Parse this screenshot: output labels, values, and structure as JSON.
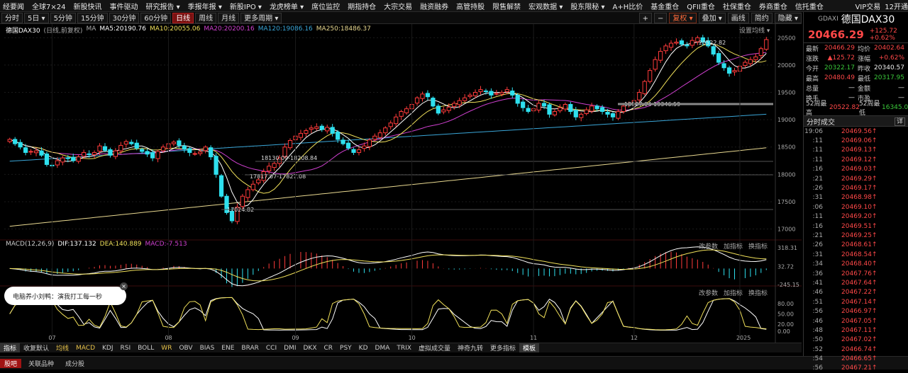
{
  "topnav": {
    "items": [
      "经要闻",
      "全球7×24",
      "新股快讯",
      "事件驱动",
      "研究报告 ▾",
      "季报年报 ▾",
      "新股IPO ▾",
      "龙虎榜单 ▾",
      "席位监控",
      "期指持仓",
      "大宗交易",
      "融资融券",
      "高管持股",
      "限售解禁",
      "宏观数据 ▾",
      "股东限秘 ▾",
      "A+H比价",
      "基金重仓",
      "QFII重仓",
      "社保重仓",
      "券商重仓",
      "信托重仓"
    ],
    "right": [
      "VIP交易",
      "12开通"
    ]
  },
  "toolbar": {
    "periods": [
      "分时",
      "5日 ▾",
      "5分钟",
      "15分钟",
      "30分钟",
      "60分钟",
      "日线",
      "周线",
      "月线",
      "更多周期 ▾"
    ],
    "active": "日线",
    "right": [
      "+",
      "−",
      "复权 ▾",
      "叠加 ▾",
      "画线",
      "简约",
      "隐藏 ▾"
    ]
  },
  "legend": {
    "name": "德国DAX30",
    "mode": "(日线,前复权)",
    "ma": "MA",
    "ma5": "MA5:20190.76",
    "ma10": "MA10:20055.06",
    "ma20": "MA20:20200.16",
    "ma120": "MA120:19086.16",
    "ma250": "MA250:18486.37",
    "settings": "设置均线 ▾",
    "colors": {
      "ma5": "#ffffff",
      "ma10": "#f0e05a",
      "ma20": "#d040d0",
      "ma120": "#3aa6d8",
      "ma250": "#e8d890"
    }
  },
  "macd": {
    "label": "MACD(12,26,9)",
    "dif": "DIF:137.132",
    "dea": "DEA:140.889",
    "macd": "MACD:-7.513",
    "links": [
      "改参数",
      "加指标",
      "换指标"
    ]
  },
  "sub": {
    "links": [
      "改参数",
      "加指标",
      "换指标"
    ]
  },
  "popup": {
    "text": "电脑养小刘鸭：演我打工每一秒",
    "close": "×"
  },
  "indicators": {
    "items": [
      "指标",
      "收复默认",
      "均线",
      "MACD",
      "KDJ",
      "RSI",
      "BOLL",
      "WR",
      "OBV",
      "BIAS",
      "ENE",
      "BRAR",
      "CCI",
      "DMI",
      "DKX",
      "CR",
      "PSY",
      "KD",
      "DMA",
      "TRIX",
      "虚拟成交量",
      "神奇九转",
      "更多指标",
      "模板"
    ],
    "selected": [
      "均线",
      "MACD",
      "WR"
    ]
  },
  "bottom": {
    "tabs": [
      "股吧",
      "关联品种",
      "成分股"
    ],
    "active": "股吧"
  },
  "side": {
    "code": "GDAXI",
    "name": "德国DAX30",
    "price": "20466.29",
    "change": "+125.72",
    "change_pct": "+0.62%",
    "rows": [
      {
        "l1": "最新",
        "v1": "20466.29",
        "c1": "red",
        "l2": "均价",
        "v2": "20402.64",
        "c2": "red"
      },
      {
        "l1": "涨跌",
        "v1": "▲125.72",
        "c1": "red",
        "l2": "涨幅",
        "v2": "+0.62%",
        "c2": "red"
      },
      {
        "l1": "今开",
        "v1": "20322.17",
        "c1": "green",
        "l2": "昨收",
        "v2": "20340.57",
        "c2": "white"
      },
      {
        "l1": "最高",
        "v1": "20480.49",
        "c1": "red",
        "l2": "最低",
        "v2": "20317.95",
        "c2": "green"
      },
      {
        "l1": "总量",
        "v1": "—",
        "c1": "white",
        "l2": "金额",
        "v2": "—",
        "c2": "white"
      },
      {
        "l1": "换手",
        "v1": "—",
        "c1": "white",
        "l2": "市盈",
        "v2": "—",
        "c2": "white"
      },
      {
        "l1": "52周最高",
        "v1": "20522.82",
        "c1": "red",
        "l2": "52周最低",
        "v2": "16345.02",
        "c2": "green"
      }
    ],
    "ticks_title": "分时成交",
    "ticks_btn": "详",
    "ticks": [
      {
        "t": "19:06",
        "p": "20469.56"
      },
      {
        "t": ":11",
        "p": "20469.06"
      },
      {
        "t": ":11",
        "p": "20469.13"
      },
      {
        "t": ":11",
        "p": "20469.12"
      },
      {
        "t": ":16",
        "p": "20469.03"
      },
      {
        "t": ":21",
        "p": "20469.29"
      },
      {
        "t": ":26",
        "p": "20469.17"
      },
      {
        "t": ":31",
        "p": "20468.98"
      },
      {
        "t": ":06",
        "p": "20469.10"
      },
      {
        "t": ":11",
        "p": "20469.20"
      },
      {
        "t": ":16",
        "p": "20469.51"
      },
      {
        "t": ":21",
        "p": "20469.25"
      },
      {
        "t": ":26",
        "p": "20468.61"
      },
      {
        "t": ":31",
        "p": "20468.54"
      },
      {
        "t": ":34",
        "p": "20468.40"
      },
      {
        "t": ":36",
        "p": "20467.76"
      },
      {
        "t": ":41",
        "p": "20467.64"
      },
      {
        "t": ":46",
        "p": "20467.22"
      },
      {
        "t": ":51",
        "p": "20467.14"
      },
      {
        "t": ":56",
        "p": "20466.97"
      },
      {
        "t": ":46",
        "p": "20467.05"
      },
      {
        "t": ":48",
        "p": "20467.11"
      },
      {
        "t": ":50",
        "p": "20467.02"
      },
      {
        "t": ":52",
        "p": "20466.74"
      },
      {
        "t": ":54",
        "p": "20466.65"
      },
      {
        "t": ":56",
        "p": "20467.21"
      }
    ]
  },
  "chart_data": {
    "type": "candlestick",
    "price_ticks": [
      20500,
      20000,
      19500,
      19000,
      18500,
      18000,
      17500,
      17000
    ],
    "price_ylim": [
      16800,
      20750
    ],
    "x_months": [
      "07",
      "08",
      "09",
      "10",
      "11",
      "12",
      "2025"
    ],
    "annotations": [
      {
        "text": "20522.82",
        "value": 20522.82
      },
      {
        "text": "18987.04-19346.59"
      },
      {
        "text": "18130.09-18208.84"
      },
      {
        "text": "17817.07-17827.08"
      },
      {
        "text": "17024.82",
        "value": 17024.82
      }
    ],
    "macd_ticks": [
      318.31,
      32.72,
      -245.15
    ],
    "sub_ticks": [
      80.0,
      50.0,
      20.0,
      0.0
    ],
    "closes": [
      18640,
      18560,
      18500,
      18400,
      18420,
      18430,
      18350,
      18180,
      18160,
      18250,
      18300,
      18290,
      18250,
      18320,
      18400,
      18360,
      18400,
      18520,
      18440,
      18350,
      18430,
      18530,
      18600,
      18560,
      18480,
      18420,
      18370,
      18300,
      18420,
      18500,
      18560,
      18590,
      18530,
      18460,
      18400,
      18380,
      18410,
      18500,
      18320,
      18000,
      17600,
      17300,
      17150,
      17400,
      17600,
      17720,
      17820,
      17900,
      18050,
      18150,
      18200,
      18300,
      18500,
      18620,
      18700,
      18750,
      18800,
      18850,
      18870,
      18820,
      18860,
      18750,
      18640,
      18560,
      18480,
      18400,
      18450,
      18520,
      18630,
      18700,
      18760,
      18850,
      18940,
      19050,
      19150,
      19200,
      19280,
      19400,
      19470,
      19420,
      19250,
      19120,
      19180,
      19230,
      19300,
      19350,
      19400,
      19450,
      19500,
      19550,
      19520,
      19450,
      19480,
      19500,
      19550,
      19450,
      19300,
      19220,
      19150,
      19200,
      19300,
      19250,
      19100,
      19150,
      19220,
      19280,
      19150,
      19050,
      19100,
      19180,
      19250,
      19200,
      19150,
      19100,
      19050,
      19150,
      19250,
      19300,
      19350,
      19500,
      19700,
      19900,
      20100,
      20250,
      20350,
      20400,
      20420,
      20380,
      20350,
      20450,
      20500,
      20420,
      20350,
      20200,
      20050,
      19950,
      19850,
      19900,
      19980,
      20050,
      20100,
      20150,
      20300,
      20466
    ]
  }
}
